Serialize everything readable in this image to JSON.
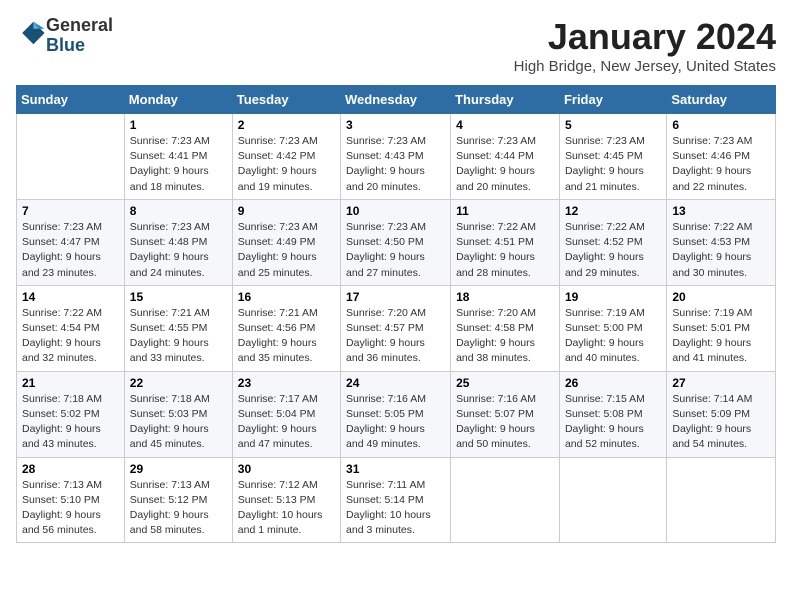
{
  "logo": {
    "general": "General",
    "blue": "Blue"
  },
  "title": "January 2024",
  "subtitle": "High Bridge, New Jersey, United States",
  "header_days": [
    "Sunday",
    "Monday",
    "Tuesday",
    "Wednesday",
    "Thursday",
    "Friday",
    "Saturday"
  ],
  "weeks": [
    [
      {
        "day": "",
        "info": ""
      },
      {
        "day": "1",
        "info": "Sunrise: 7:23 AM\nSunset: 4:41 PM\nDaylight: 9 hours\nand 18 minutes."
      },
      {
        "day": "2",
        "info": "Sunrise: 7:23 AM\nSunset: 4:42 PM\nDaylight: 9 hours\nand 19 minutes."
      },
      {
        "day": "3",
        "info": "Sunrise: 7:23 AM\nSunset: 4:43 PM\nDaylight: 9 hours\nand 20 minutes."
      },
      {
        "day": "4",
        "info": "Sunrise: 7:23 AM\nSunset: 4:44 PM\nDaylight: 9 hours\nand 20 minutes."
      },
      {
        "day": "5",
        "info": "Sunrise: 7:23 AM\nSunset: 4:45 PM\nDaylight: 9 hours\nand 21 minutes."
      },
      {
        "day": "6",
        "info": "Sunrise: 7:23 AM\nSunset: 4:46 PM\nDaylight: 9 hours\nand 22 minutes."
      }
    ],
    [
      {
        "day": "7",
        "info": "Sunrise: 7:23 AM\nSunset: 4:47 PM\nDaylight: 9 hours\nand 23 minutes."
      },
      {
        "day": "8",
        "info": "Sunrise: 7:23 AM\nSunset: 4:48 PM\nDaylight: 9 hours\nand 24 minutes."
      },
      {
        "day": "9",
        "info": "Sunrise: 7:23 AM\nSunset: 4:49 PM\nDaylight: 9 hours\nand 25 minutes."
      },
      {
        "day": "10",
        "info": "Sunrise: 7:23 AM\nSunset: 4:50 PM\nDaylight: 9 hours\nand 27 minutes."
      },
      {
        "day": "11",
        "info": "Sunrise: 7:22 AM\nSunset: 4:51 PM\nDaylight: 9 hours\nand 28 minutes."
      },
      {
        "day": "12",
        "info": "Sunrise: 7:22 AM\nSunset: 4:52 PM\nDaylight: 9 hours\nand 29 minutes."
      },
      {
        "day": "13",
        "info": "Sunrise: 7:22 AM\nSunset: 4:53 PM\nDaylight: 9 hours\nand 30 minutes."
      }
    ],
    [
      {
        "day": "14",
        "info": "Sunrise: 7:22 AM\nSunset: 4:54 PM\nDaylight: 9 hours\nand 32 minutes."
      },
      {
        "day": "15",
        "info": "Sunrise: 7:21 AM\nSunset: 4:55 PM\nDaylight: 9 hours\nand 33 minutes."
      },
      {
        "day": "16",
        "info": "Sunrise: 7:21 AM\nSunset: 4:56 PM\nDaylight: 9 hours\nand 35 minutes."
      },
      {
        "day": "17",
        "info": "Sunrise: 7:20 AM\nSunset: 4:57 PM\nDaylight: 9 hours\nand 36 minutes."
      },
      {
        "day": "18",
        "info": "Sunrise: 7:20 AM\nSunset: 4:58 PM\nDaylight: 9 hours\nand 38 minutes."
      },
      {
        "day": "19",
        "info": "Sunrise: 7:19 AM\nSunset: 5:00 PM\nDaylight: 9 hours\nand 40 minutes."
      },
      {
        "day": "20",
        "info": "Sunrise: 7:19 AM\nSunset: 5:01 PM\nDaylight: 9 hours\nand 41 minutes."
      }
    ],
    [
      {
        "day": "21",
        "info": "Sunrise: 7:18 AM\nSunset: 5:02 PM\nDaylight: 9 hours\nand 43 minutes."
      },
      {
        "day": "22",
        "info": "Sunrise: 7:18 AM\nSunset: 5:03 PM\nDaylight: 9 hours\nand 45 minutes."
      },
      {
        "day": "23",
        "info": "Sunrise: 7:17 AM\nSunset: 5:04 PM\nDaylight: 9 hours\nand 47 minutes."
      },
      {
        "day": "24",
        "info": "Sunrise: 7:16 AM\nSunset: 5:05 PM\nDaylight: 9 hours\nand 49 minutes."
      },
      {
        "day": "25",
        "info": "Sunrise: 7:16 AM\nSunset: 5:07 PM\nDaylight: 9 hours\nand 50 minutes."
      },
      {
        "day": "26",
        "info": "Sunrise: 7:15 AM\nSunset: 5:08 PM\nDaylight: 9 hours\nand 52 minutes."
      },
      {
        "day": "27",
        "info": "Sunrise: 7:14 AM\nSunset: 5:09 PM\nDaylight: 9 hours\nand 54 minutes."
      }
    ],
    [
      {
        "day": "28",
        "info": "Sunrise: 7:13 AM\nSunset: 5:10 PM\nDaylight: 9 hours\nand 56 minutes."
      },
      {
        "day": "29",
        "info": "Sunrise: 7:13 AM\nSunset: 5:12 PM\nDaylight: 9 hours\nand 58 minutes."
      },
      {
        "day": "30",
        "info": "Sunrise: 7:12 AM\nSunset: 5:13 PM\nDaylight: 10 hours\nand 1 minute."
      },
      {
        "day": "31",
        "info": "Sunrise: 7:11 AM\nSunset: 5:14 PM\nDaylight: 10 hours\nand 3 minutes."
      },
      {
        "day": "",
        "info": ""
      },
      {
        "day": "",
        "info": ""
      },
      {
        "day": "",
        "info": ""
      }
    ]
  ]
}
